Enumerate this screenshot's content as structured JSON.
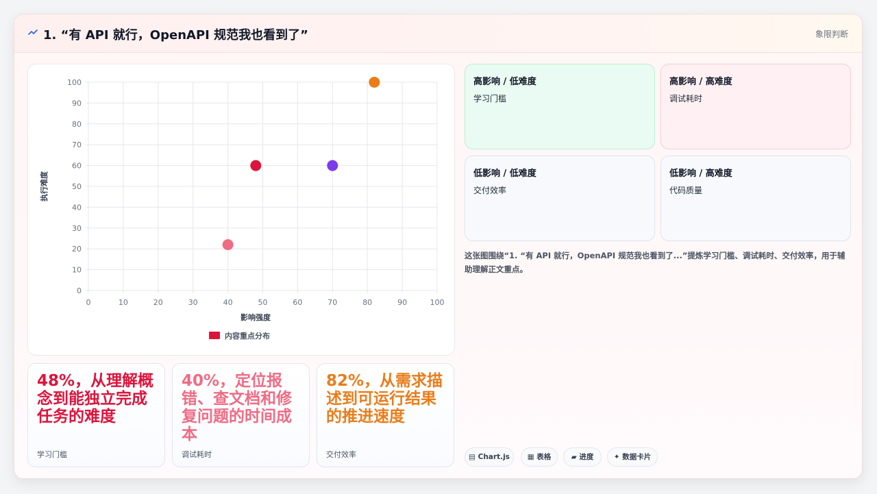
{
  "header": {
    "icon": "wave-line-icon",
    "title": "1. “有 API 就行，OpenAPI 规范我也看到了”",
    "tag": "象限判断"
  },
  "chart_data": {
    "type": "scatter",
    "xlabel": "影响强度",
    "ylabel": "执行难度",
    "xlim": [
      0,
      100
    ],
    "ylim": [
      0,
      100
    ],
    "xticks": [
      "0",
      "10",
      "20",
      "30",
      "40",
      "50",
      "60",
      "70",
      "80",
      "90",
      "100"
    ],
    "yticks": [
      "0",
      "10",
      "20",
      "30",
      "40",
      "50",
      "60",
      "70",
      "80",
      "90",
      "100"
    ],
    "grid": true,
    "legend": {
      "label": "内容重点分布",
      "position": "bottom",
      "color": "#dc143c"
    },
    "points": [
      {
        "x": 40,
        "y": 22,
        "color": "#f06b84"
      },
      {
        "x": 48,
        "y": 60,
        "color": "#dc143c"
      },
      {
        "x": 70,
        "y": 60,
        "color": "#7c3aed"
      },
      {
        "x": 82,
        "y": 100,
        "color": "#ea7d1a"
      }
    ]
  },
  "stats": [
    {
      "value": "48%，从理解概念到能独立完成任务的难度",
      "label": "学习门槛",
      "color": "#dc143c"
    },
    {
      "value": "40%，定位报错、查文档和修复问题的时间成本",
      "label": "调试耗时",
      "color": "#f06b84"
    },
    {
      "value": "82%，从需求描述到可运行结果的推进速度",
      "label": "交付效率",
      "color": "#ea7d1a"
    }
  ],
  "quadrants": [
    {
      "title": "高影响 / 低难度",
      "item": "学习门槛",
      "bg": "#eafbf3",
      "border": "#bdeed3"
    },
    {
      "title": "高影响 / 高难度",
      "item": "调试耗时",
      "bg": "#fff1f3",
      "border": "#f6cdd5"
    },
    {
      "title": "低影响 / 低难度",
      "item": "交付效率",
      "bg": "#f7f9fc",
      "border": "#dfe5ee"
    },
    {
      "title": "低影响 / 高难度",
      "item": "代码质量",
      "bg": "#f7f9fc",
      "border": "#dfe5ee"
    }
  ],
  "description": "这张图围绕“1. “有 API 就行，OpenAPI 规范我也看到了...”提炼学习门槛、调试耗时、交付效率，用于辅助理解正文重点。",
  "chips": [
    {
      "icon": "chart-icon",
      "glyph": "▤",
      "label": "Chart.js"
    },
    {
      "icon": "table-icon",
      "glyph": "▦",
      "label": "表格"
    },
    {
      "icon": "progress-icon",
      "glyph": "▰",
      "label": "进度"
    },
    {
      "icon": "sparkle-icon",
      "glyph": "✦",
      "label": "数据卡片"
    }
  ]
}
